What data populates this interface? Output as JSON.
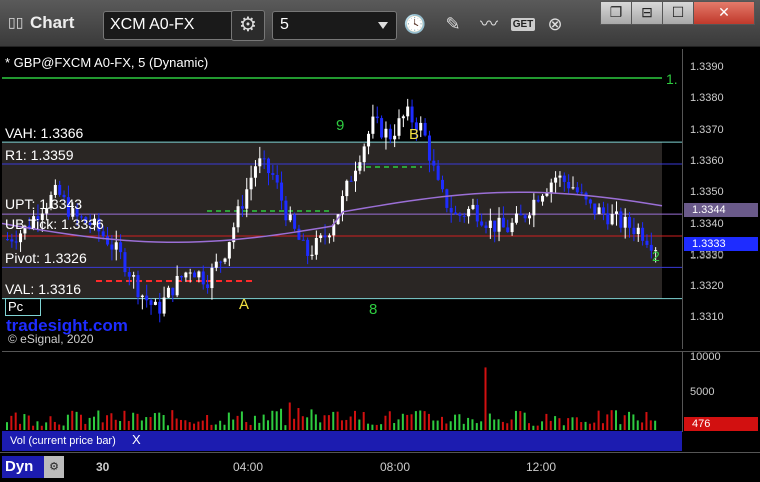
{
  "toolbar": {
    "app_title": "Chart",
    "symbol": "XCM A0-FX",
    "interval": "5",
    "get_label": "GET"
  },
  "chart": {
    "legend": "* GBP@FXCM A0-FX, 5 (Dynamic)",
    "levels": [
      {
        "label": "VAH: 1.3366",
        "price": 1.3366,
        "color": "#7fd4d4"
      },
      {
        "label": "R1: 1.3359",
        "price": 1.3359,
        "color": "#3a3ad6"
      },
      {
        "label": "UPT: 1.3343",
        "price": 1.3343,
        "color": "#9b6fd6"
      },
      {
        "label": "UB Tick: 1.3336",
        "price": 1.3336,
        "color": "#d02020"
      },
      {
        "label": "Pivot: 1.3326",
        "price": 1.3326,
        "color": "#3a3ad6"
      },
      {
        "label": "VAL: 1.3316",
        "price": 1.3316,
        "color": "#7fd4d4"
      }
    ],
    "top_line_label": "1.",
    "markers": {
      "a": "A",
      "b": "B",
      "nine": "9",
      "eight": "8",
      "two": "2"
    },
    "pc_label": "Pc",
    "watermark": "tradesight.com",
    "copyright": "© eSignal, 2020",
    "price_ticks": [
      "1.3390",
      "1.3380",
      "1.3370",
      "1.3360",
      "1.3350",
      "1.3340",
      "1.3330",
      "1.3320",
      "1.3310"
    ],
    "current_price_1": "1.3344",
    "current_price_2": "1.3333",
    "current_price_3": "1.3330"
  },
  "volume": {
    "ticks": [
      "10000",
      "5000"
    ],
    "current": "476",
    "footer_label": "Vol (current price bar)",
    "close": "X"
  },
  "time_axis": {
    "mode": "Dyn",
    "labels": [
      "30",
      "04:00",
      "08:00",
      "12:00"
    ]
  },
  "colors": {
    "up_candle": "#ffffff",
    "down_candle": "#1e2cff",
    "ma": "#9b6fd6",
    "accent_blue": "#1c1cb0",
    "marker_green": "#2ecc40",
    "marker_yellow": "#f0e040"
  }
}
